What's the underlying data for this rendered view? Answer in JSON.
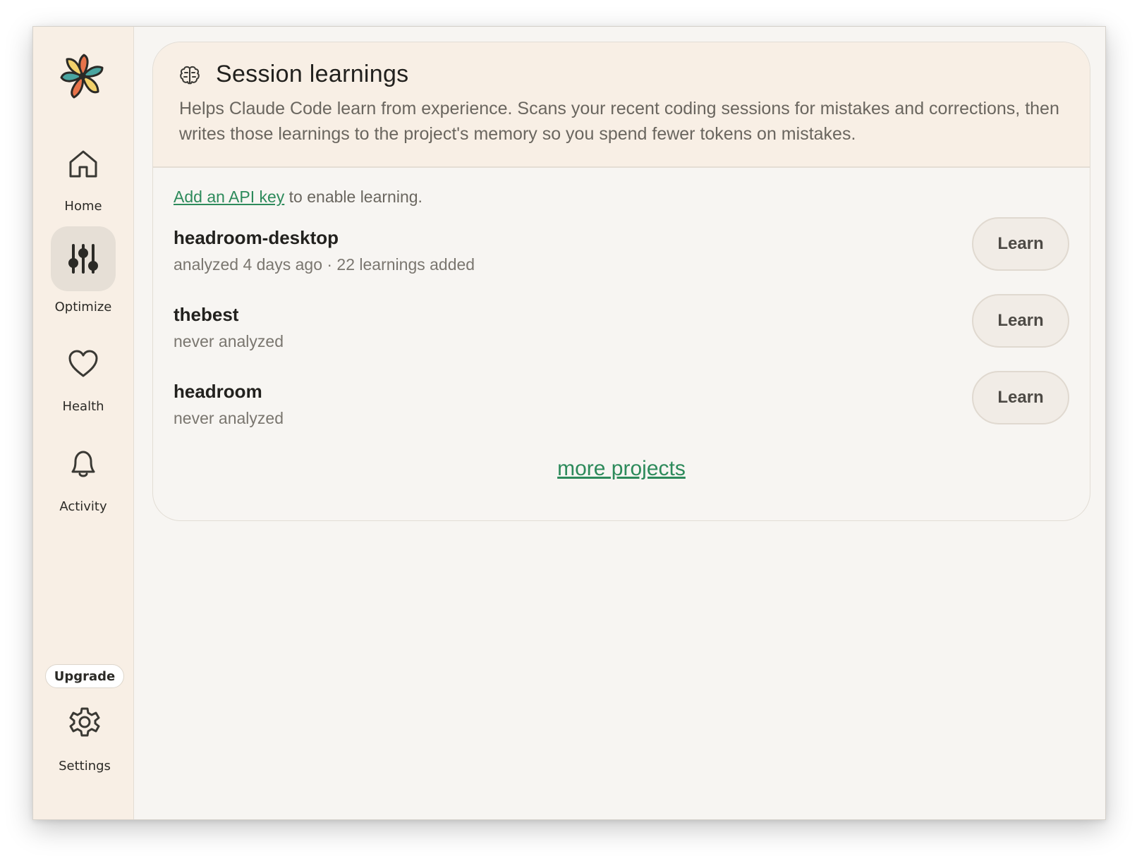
{
  "sidebar": {
    "logo": "flower-logo",
    "items": [
      {
        "label": "Home",
        "icon": "home-icon"
      },
      {
        "label": "Optimize",
        "icon": "sliders-icon",
        "active": true
      },
      {
        "label": "Health",
        "icon": "heart-icon"
      },
      {
        "label": "Activity",
        "icon": "bell-icon"
      }
    ],
    "upgrade_label": "Upgrade",
    "settings_label": "Settings",
    "settings_icon": "gear-icon"
  },
  "card": {
    "icon": "brain-icon",
    "title": "Session learnings",
    "description": "Helps Claude Code learn from experience. Scans your recent coding sessions for mistakes and corrections, then writes those learnings to the project's memory so you spend fewer tokens on mistakes.",
    "api_link": "Add an API key",
    "api_suffix": " to enable learning.",
    "projects": [
      {
        "name": "headroom-desktop",
        "status": "analyzed 4 days ago · 22 learnings added",
        "button": "Learn"
      },
      {
        "name": "thebest",
        "status": "never analyzed",
        "button": "Learn"
      },
      {
        "name": "headroom",
        "status": "never analyzed",
        "button": "Learn"
      }
    ],
    "more_label": "more projects"
  },
  "colors": {
    "accent_green": "#2d8a5b",
    "sidebar_bg": "#f8efe5",
    "active_bg": "#e6dfd6"
  }
}
